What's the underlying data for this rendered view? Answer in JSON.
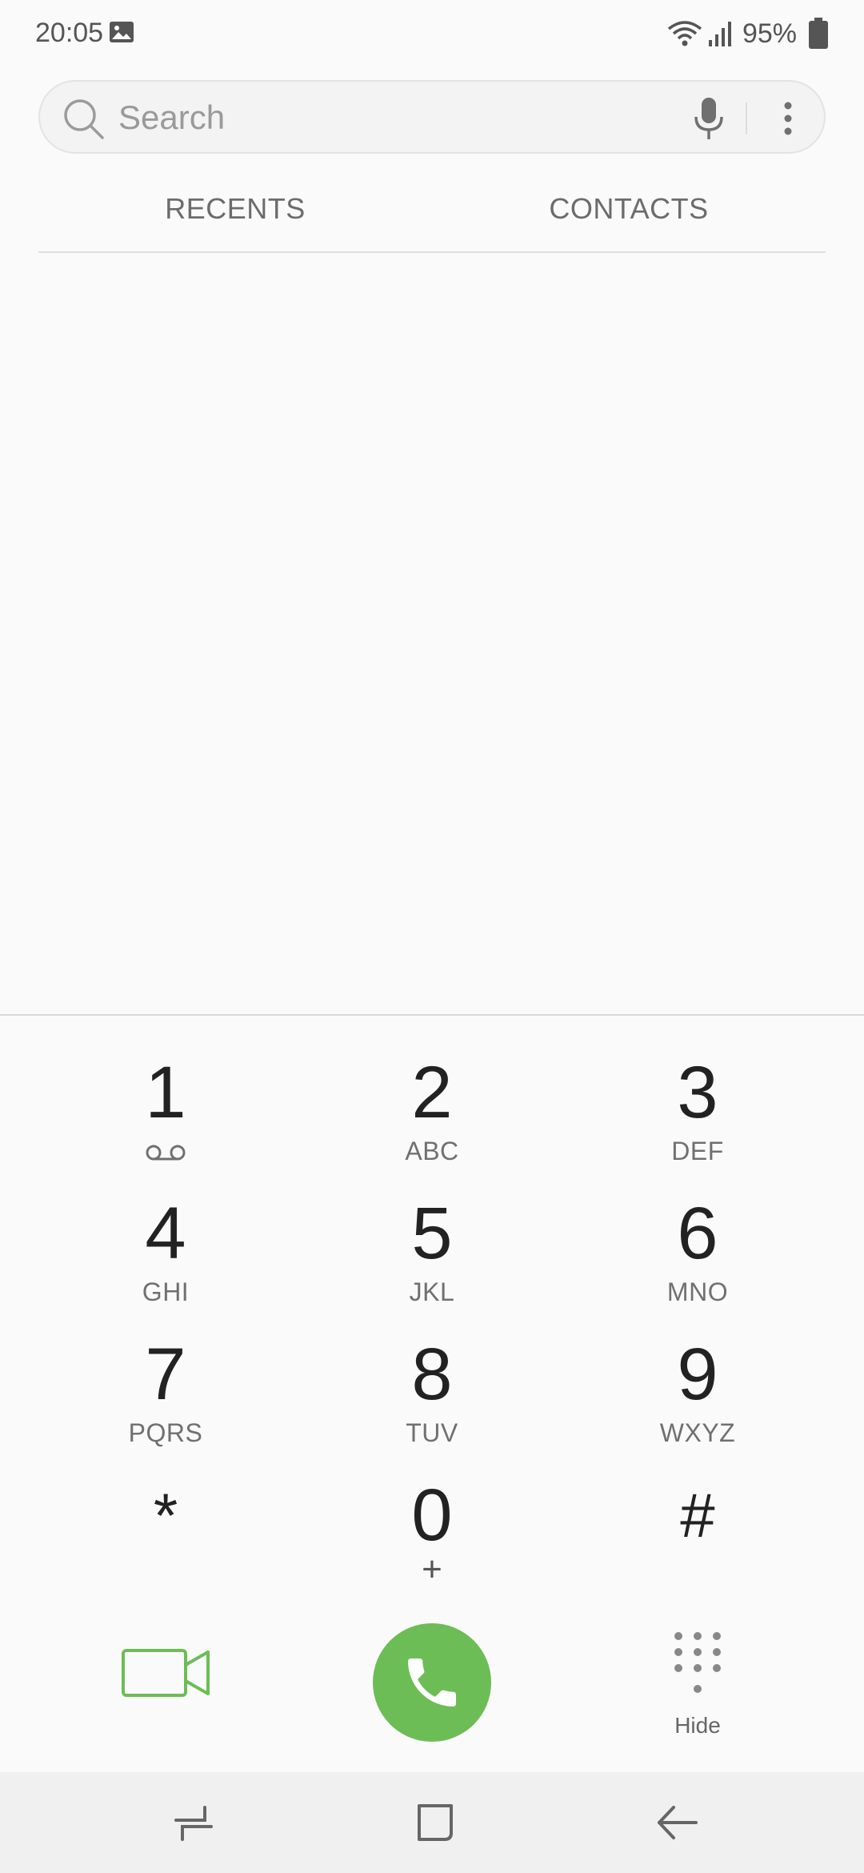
{
  "status_bar": {
    "time": "20:05",
    "battery_percent": "95%",
    "icons": [
      "gallery-icon",
      "wifi-icon",
      "signal-icon",
      "battery-icon"
    ]
  },
  "search": {
    "placeholder": "Search",
    "value": "",
    "icons": [
      "search-icon",
      "mic-icon",
      "more-options-icon"
    ]
  },
  "tabs": [
    {
      "label": "RECENTS"
    },
    {
      "label": "CONTACTS"
    }
  ],
  "dialpad": {
    "keys": [
      {
        "digit": "1",
        "letters": ""
      },
      {
        "digit": "2",
        "letters": "ABC"
      },
      {
        "digit": "3",
        "letters": "DEF"
      },
      {
        "digit": "4",
        "letters": "GHI"
      },
      {
        "digit": "5",
        "letters": "JKL"
      },
      {
        "digit": "6",
        "letters": "MNO"
      },
      {
        "digit": "7",
        "letters": "PQRS"
      },
      {
        "digit": "8",
        "letters": "TUV"
      },
      {
        "digit": "9",
        "letters": "WXYZ"
      },
      {
        "digit": "*",
        "letters": ""
      },
      {
        "digit": "0",
        "letters": "+"
      },
      {
        "digit": "#",
        "letters": ""
      }
    ]
  },
  "actions": {
    "hide_label": "Hide",
    "icons": [
      "video-call-icon",
      "phone-icon",
      "dialpad-icon"
    ]
  },
  "colors": {
    "accent_green": "#6cbd55",
    "background": "#fafafa",
    "nav_background": "#f0f0f0"
  },
  "nav_bar": {
    "icons": [
      "recent-apps-icon",
      "home-icon",
      "back-icon"
    ]
  }
}
